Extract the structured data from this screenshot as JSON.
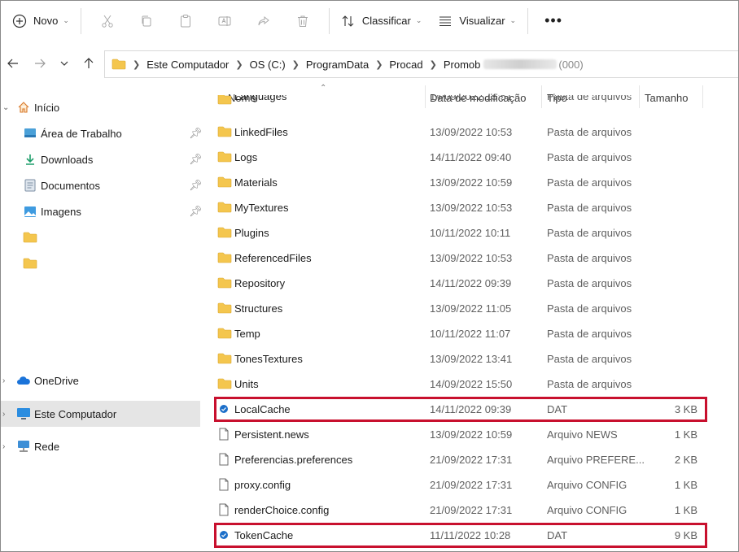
{
  "toolbar": {
    "new_label": "Novo",
    "sort_label": "Classificar",
    "view_label": "Visualizar",
    "more_label": "•••"
  },
  "address": {
    "crumbs": [
      "Este Computador",
      "OS (C:)",
      "ProgramData",
      "Procad",
      "Promob"
    ],
    "tail_text": "(000)"
  },
  "sidebar": {
    "items": [
      {
        "label": "Início",
        "icon": "home-icon"
      },
      {
        "label": "Área de Trabalho",
        "icon": "desktop-icon",
        "pinned": true
      },
      {
        "label": "Downloads",
        "icon": "download-icon",
        "pinned": true
      },
      {
        "label": "Documentos",
        "icon": "documents-icon",
        "pinned": true
      },
      {
        "label": "Imagens",
        "icon": "pictures-icon",
        "pinned": true
      },
      {
        "label": "",
        "icon": "folder-icon"
      },
      {
        "label": "",
        "icon": "folder-icon"
      },
      {
        "label": "OneDrive",
        "icon": "cloud-icon"
      },
      {
        "label": "Este Computador",
        "icon": "computer-icon",
        "selected": true
      },
      {
        "label": "Rede",
        "icon": "network-icon"
      }
    ]
  },
  "columns": {
    "name": "Nome",
    "date": "Data de modificação",
    "type": "Tipo",
    "size": "Tamanho"
  },
  "files": [
    {
      "name": "Languages",
      "date": "14/09/2022 15:51",
      "type": "Pasta de arquivos",
      "size": "",
      "kind": "folder"
    },
    {
      "name": "LinkedFiles",
      "date": "13/09/2022 10:53",
      "type": "Pasta de arquivos",
      "size": "",
      "kind": "folder"
    },
    {
      "name": "Logs",
      "date": "14/11/2022 09:40",
      "type": "Pasta de arquivos",
      "size": "",
      "kind": "folder"
    },
    {
      "name": "Materials",
      "date": "13/09/2022 10:59",
      "type": "Pasta de arquivos",
      "size": "",
      "kind": "folder"
    },
    {
      "name": "MyTextures",
      "date": "13/09/2022 10:53",
      "type": "Pasta de arquivos",
      "size": "",
      "kind": "folder"
    },
    {
      "name": "Plugins",
      "date": "10/11/2022 10:11",
      "type": "Pasta de arquivos",
      "size": "",
      "kind": "folder"
    },
    {
      "name": "ReferencedFiles",
      "date": "13/09/2022 10:53",
      "type": "Pasta de arquivos",
      "size": "",
      "kind": "folder"
    },
    {
      "name": "Repository",
      "date": "14/11/2022 09:39",
      "type": "Pasta de arquivos",
      "size": "",
      "kind": "folder"
    },
    {
      "name": "Structures",
      "date": "13/09/2022 11:05",
      "type": "Pasta de arquivos",
      "size": "",
      "kind": "folder"
    },
    {
      "name": "Temp",
      "date": "10/11/2022 11:07",
      "type": "Pasta de arquivos",
      "size": "",
      "kind": "folder"
    },
    {
      "name": "TonesTextures",
      "date": "13/09/2022 13:41",
      "type": "Pasta de arquivos",
      "size": "",
      "kind": "folder"
    },
    {
      "name": "Units",
      "date": "14/09/2022 15:50",
      "type": "Pasta de arquivos",
      "size": "",
      "kind": "folder"
    },
    {
      "name": "LocalCache",
      "date": "14/11/2022 09:39",
      "type": "DAT",
      "size": "3 KB",
      "kind": "dat",
      "highlighted": true
    },
    {
      "name": "Persistent.news",
      "date": "13/09/2022 10:59",
      "type": "Arquivo NEWS",
      "size": "1 KB",
      "kind": "file"
    },
    {
      "name": "Preferencias.preferences",
      "date": "21/09/2022 17:31",
      "type": "Arquivo PREFERE...",
      "size": "2 KB",
      "kind": "file"
    },
    {
      "name": "proxy.config",
      "date": "21/09/2022 17:31",
      "type": "Arquivo CONFIG",
      "size": "1 KB",
      "kind": "file"
    },
    {
      "name": "renderChoice.config",
      "date": "21/09/2022 17:31",
      "type": "Arquivo CONFIG",
      "size": "1 KB",
      "kind": "file"
    },
    {
      "name": "TokenCache",
      "date": "11/11/2022 10:28",
      "type": "DAT",
      "size": "9 KB",
      "kind": "dat",
      "highlighted": true
    }
  ],
  "colors": {
    "highlight": "#c8102e",
    "folder": "#f4c64e",
    "selected_bg": "#e5e5e5",
    "accent": "#0078d4"
  }
}
